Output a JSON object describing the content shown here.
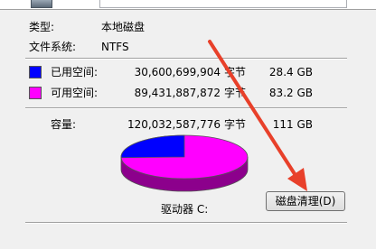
{
  "properties": {
    "type_label": "类型:",
    "type_value": "本地磁盘",
    "fs_label": "文件系统:",
    "fs_value": "NTFS"
  },
  "space": {
    "used": {
      "label": "已用空间:",
      "bytes": "30,600,699,904",
      "unit": "字节",
      "size": "28.4 GB",
      "color": "#0000ff"
    },
    "free": {
      "label": "可用空间:",
      "bytes": "89,431,887,872",
      "unit": "字节",
      "size": "83.2 GB",
      "color": "#ff00ff"
    },
    "capacity": {
      "label": "容量:",
      "bytes": "120,032,587,776",
      "unit": "字节",
      "size": "111 GB"
    }
  },
  "drive_label": "驱动器 C:",
  "cleanup_button": "磁盘清理(D)",
  "pie": {
    "used_fraction": 0.255,
    "used_color": "#0000ff",
    "free_color": "#ff00ff"
  },
  "annotation": {
    "arrow_color": "#e8402a"
  }
}
